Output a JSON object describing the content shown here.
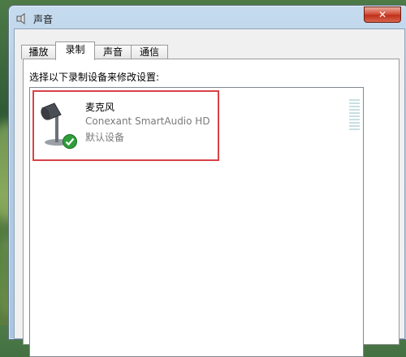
{
  "window": {
    "title": "声音",
    "close_glyph": "✕"
  },
  "tabs": [
    {
      "label": "播放",
      "active": false
    },
    {
      "label": "录制",
      "active": true
    },
    {
      "label": "声音",
      "active": false
    },
    {
      "label": "通信",
      "active": false
    }
  ],
  "recording": {
    "instruction": "选择以下录制设备来修改设置:",
    "devices": [
      {
        "name": "麦克风",
        "description": "Conexant SmartAudio HD",
        "status": "默认设备",
        "icon": "microphone-icon",
        "badge_icon": "default-check-icon",
        "selected": true
      }
    ]
  },
  "colors": {
    "selection_border": "#d84248",
    "default_check": "#2e9e3a",
    "level_meter_bar": "#c8dfe2"
  }
}
